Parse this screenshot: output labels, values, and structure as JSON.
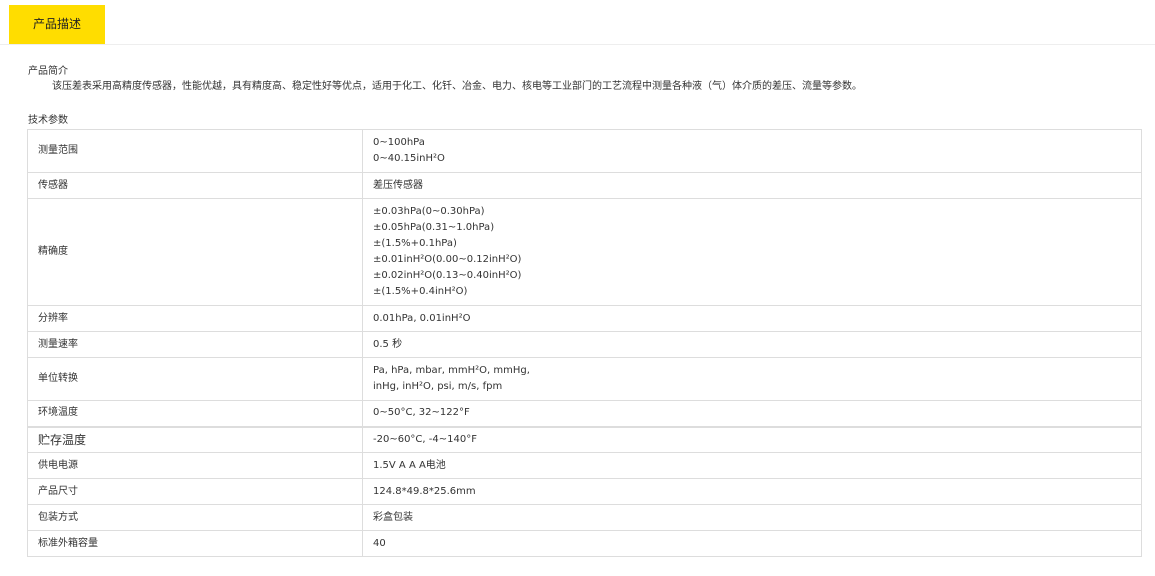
{
  "tab": {
    "label": "产品描述"
  },
  "intro": {
    "title": "产品简介",
    "text": "该压差表采用高精度传感器，性能优越，具有精度高、稳定性好等优点，适用于化工、化钎、冶金、电力、核电等工业部门的工艺流程中测量各种液（气）体介质的差压、流量等参数。"
  },
  "specs": {
    "title": "技术参数",
    "rows": [
      {
        "label": "测量范围",
        "lines": [
          "0~100hPa",
          "0~40.15inH²O"
        ]
      },
      {
        "label": "传感器",
        "lines": [
          "差压传感器"
        ]
      },
      {
        "label": "精确度",
        "lines": [
          "±0.03hPa(0~0.30hPa)",
          "±0.05hPa(0.31~1.0hPa)",
          "±(1.5%+0.1hPa)",
          "±0.01inH²O(0.00~0.12inH²O)",
          "±0.02inH²O(0.13~0.40inH²O)",
          "±(1.5%+0.4inH²O)"
        ]
      },
      {
        "label": "分辨率",
        "lines": [
          "0.01hPa, 0.01inH²O"
        ]
      },
      {
        "label": "测量速率",
        "lines": [
          "0.5 秒"
        ]
      },
      {
        "label": "单位转换",
        "lines": [
          "Pa, hPa, mbar, mmH²O, mmHg,",
          "inHg, inH²O, psi, m/s, fpm"
        ]
      },
      {
        "label": "环境温度",
        "lines": [
          "0~50°C, 32~122°F"
        ]
      },
      {
        "label": "贮存温度",
        "lines": [
          "-20~60°C, -4~140°F"
        ]
      },
      {
        "label": "供电电源",
        "lines": [
          "1.5V A A A电池"
        ]
      },
      {
        "label": "产品尺寸",
        "lines": [
          "124.8*49.8*25.6mm"
        ]
      },
      {
        "label": "包装方式",
        "lines": [
          "彩盒包装"
        ]
      },
      {
        "label": "标准外箱容量",
        "lines": [
          "40"
        ]
      }
    ]
  }
}
